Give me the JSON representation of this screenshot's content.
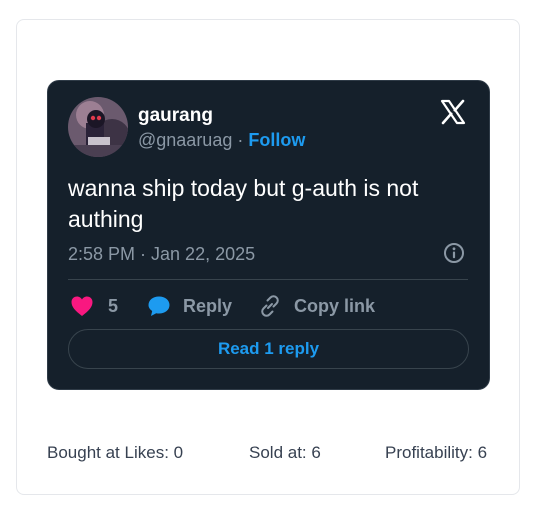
{
  "tweet": {
    "display_name": "gaurang",
    "handle": "@gnaaruag",
    "separator": "·",
    "follow_label": "Follow",
    "text": "wanna ship today but g-auth is not authing",
    "timestamp": "2:58 PM · Jan 22, 2025",
    "likes_count": "5",
    "reply_label": "Reply",
    "copy_link_label": "Copy link",
    "read_replies_label": "Read 1 reply",
    "icons": {
      "logo": "x-logo-icon",
      "info": "info-icon",
      "like": "heart-icon",
      "reply": "speech-bubble-icon",
      "copy": "link-icon"
    },
    "colors": {
      "background": "#15202b",
      "accent": "#1d9bf0",
      "like": "#f91880",
      "muted": "#8b98a5"
    }
  },
  "stats": {
    "bought": "Bought at Likes: 0",
    "sold": "Sold at: 6",
    "profitability": "Profitability: 6"
  }
}
